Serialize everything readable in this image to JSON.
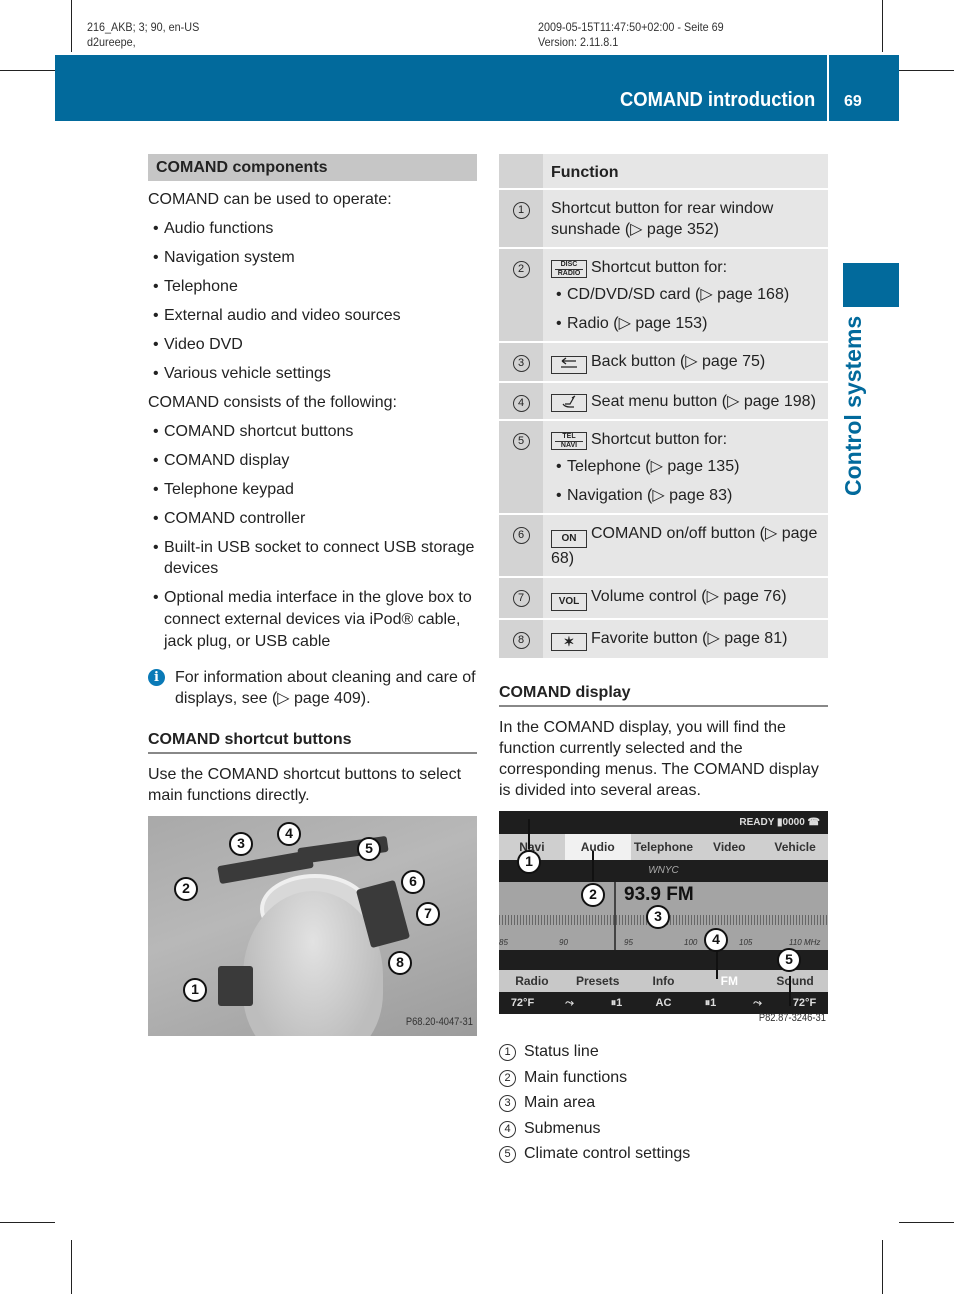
{
  "meta": {
    "left_line1": "216_AKB; 3; 90, en-US",
    "left_line2": "d2ureepe,",
    "right_line1": "2009-05-15T11:47:50+02:00 - Seite 69",
    "right_line2": "Version: 2.11.8.1"
  },
  "header": {
    "title": "COMAND introduction",
    "page_number": "69",
    "accent_color": "#026a9c"
  },
  "side_tab": {
    "label": "Control systems"
  },
  "left_column": {
    "components": {
      "heading": "COMAND components",
      "intro": "COMAND can be used to operate:",
      "operate_items": [
        "Audio functions",
        "Navigation system",
        "Telephone",
        "External audio and video sources",
        "Video DVD",
        "Various vehicle settings"
      ],
      "consists_intro": "COMAND consists of the following:",
      "consists_items": [
        "COMAND shortcut buttons",
        "COMAND display",
        "Telephone keypad",
        "COMAND controller",
        "Built-in USB socket to connect USB storage devices",
        "Optional media interface in the glove box to connect external devices via iPod® cable, jack plug, or USB cable"
      ],
      "note": "For information about cleaning and care of displays, see (▷ page 409).",
      "note_icon": "info-icon"
    },
    "shortcut": {
      "heading": "COMAND shortcut buttons",
      "text": "Use the COMAND shortcut buttons to select main functions directly.",
      "figure_code": "P68.20-4047-31",
      "callouts": [
        "1",
        "2",
        "3",
        "4",
        "5",
        "6",
        "7",
        "8"
      ]
    }
  },
  "table": {
    "header": "Function",
    "rows": [
      {
        "num": "1",
        "key": "",
        "text": "Shortcut button for rear window sunshade (▷ page 352)",
        "subitems": []
      },
      {
        "num": "2",
        "key": "DISC|RADIO",
        "text": "Shortcut button for:",
        "subitems": [
          "CD/DVD/SD card (▷ page 168)",
          "Radio (▷ page 153)"
        ]
      },
      {
        "num": "3",
        "key": "back-arrow",
        "text": "Back button (▷ page 75)",
        "subitems": []
      },
      {
        "num": "4",
        "key": "seat",
        "text": "Seat menu button (▷ page 198)",
        "subitems": []
      },
      {
        "num": "5",
        "key": "TEL|NAVI",
        "text": "Shortcut button for:",
        "subitems": [
          "Telephone (▷ page 135)",
          "Navigation (▷ page 83)"
        ]
      },
      {
        "num": "6",
        "key": "ON",
        "text": "COMAND on/off button (▷ page 68)",
        "subitems": []
      },
      {
        "num": "7",
        "key": "VOL",
        "text": "Volume control (▷ page 76)",
        "subitems": []
      },
      {
        "num": "8",
        "key": "✶",
        "text": "Favorite button (▷ page 81)",
        "subitems": []
      }
    ]
  },
  "display": {
    "heading": "COMAND display",
    "text": "In the COMAND display, you will find the function currently selected and the corresponding menus. The COMAND display is divided into several areas.",
    "screen": {
      "status": "READY ▮0000 ☎",
      "menu": [
        "Navi",
        "Audio",
        "Telephone",
        "Video",
        "Vehicle"
      ],
      "active_menu": "Audio",
      "station": "WNYC",
      "frequency": "93.9 FM",
      "scale_labels": [
        "85",
        "90",
        "95",
        "100",
        "105",
        "110 MHz"
      ],
      "submenu": [
        "Radio",
        "Presets",
        "Info",
        "FM",
        "Sound"
      ],
      "climate": [
        "72°F",
        "fan",
        "⏸1",
        "AC",
        "⏸1",
        "fan",
        "72°F"
      ],
      "figure_code": "P82.87-3246-31",
      "callouts": [
        "1",
        "2",
        "3",
        "4",
        "5"
      ]
    },
    "legend": [
      {
        "num": "1",
        "label": "Status line"
      },
      {
        "num": "2",
        "label": "Main functions"
      },
      {
        "num": "3",
        "label": "Main area"
      },
      {
        "num": "4",
        "label": "Submenus"
      },
      {
        "num": "5",
        "label": "Climate control settings"
      }
    ]
  }
}
